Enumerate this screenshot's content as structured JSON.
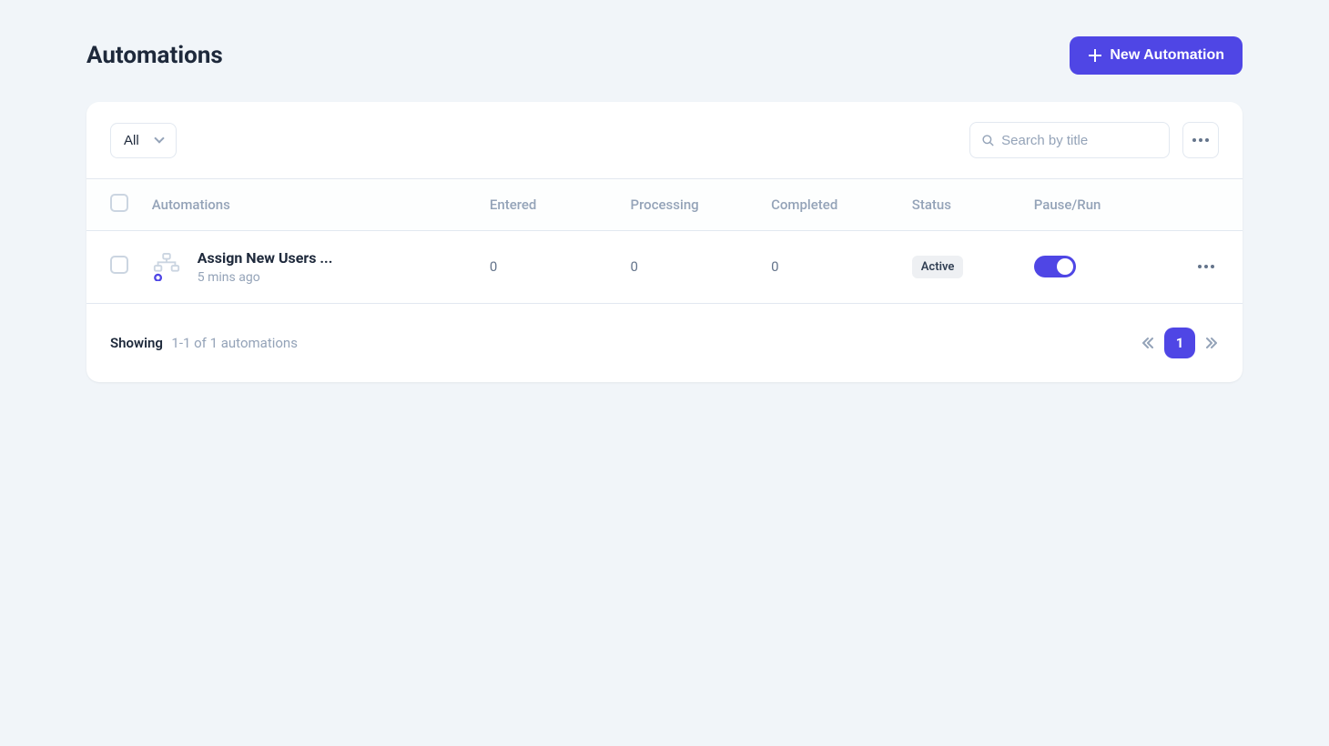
{
  "header": {
    "title": "Automations",
    "new_btn_label": "New Automation"
  },
  "toolbar": {
    "filter_label": "All",
    "search_placeholder": "Search by title"
  },
  "table": {
    "headers": {
      "automations": "Automations",
      "entered": "Entered",
      "processing": "Processing",
      "completed": "Completed",
      "status": "Status",
      "pause_run": "Pause/Run"
    },
    "rows": [
      {
        "title": "Assign New Users ...",
        "time": "5 mins ago",
        "entered": "0",
        "processing": "0",
        "completed": "0",
        "status": "Active",
        "running": true
      }
    ]
  },
  "footer": {
    "showing_label": "Showing",
    "showing_detail": "1-1 of 1 automations",
    "current_page": "1"
  }
}
